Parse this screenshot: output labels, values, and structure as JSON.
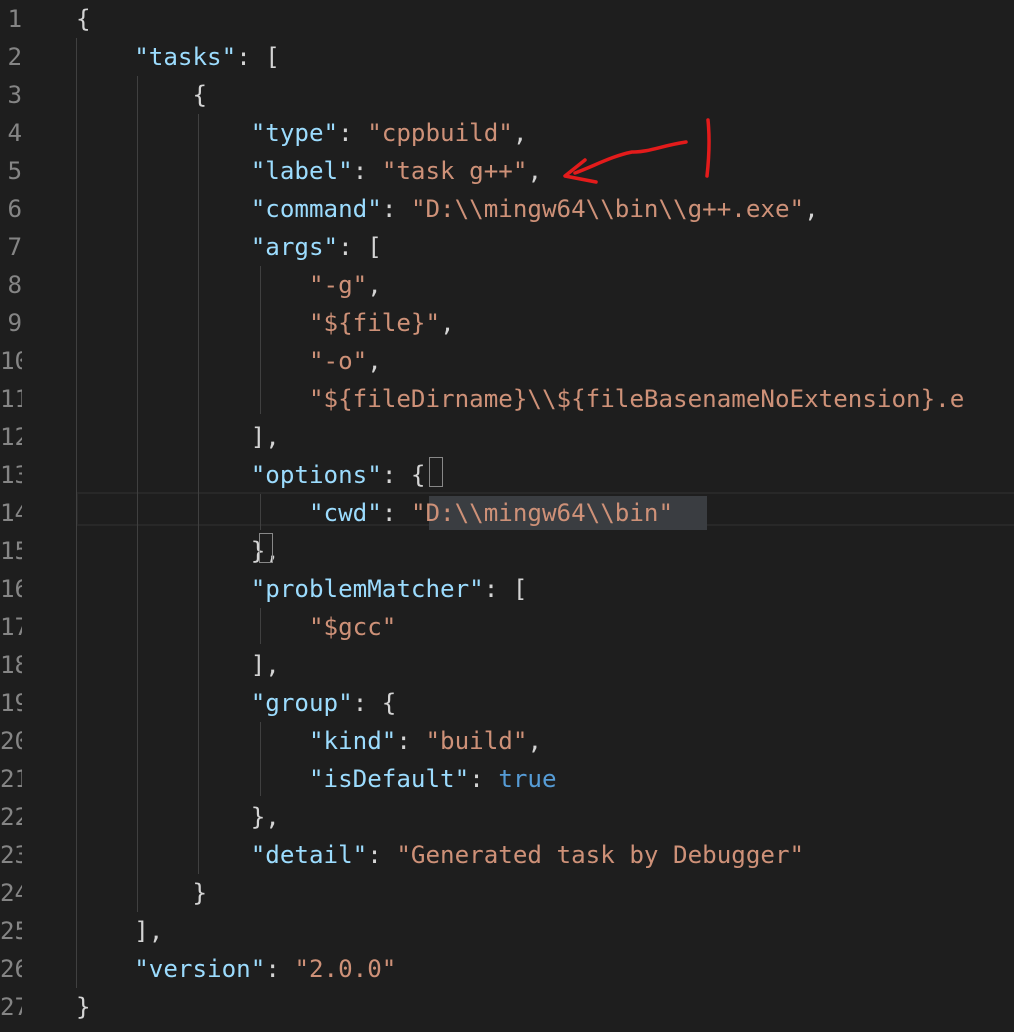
{
  "editor": {
    "language": "json",
    "lines": [
      {
        "number": "1",
        "tokens": [
          {
            "t": "p",
            "v": "{"
          }
        ]
      },
      {
        "number": "2",
        "tokens": [
          {
            "t": "p",
            "v": "    "
          },
          {
            "t": "k",
            "v": "\"tasks\""
          },
          {
            "t": "p",
            "v": ": ["
          }
        ]
      },
      {
        "number": "3",
        "tokens": [
          {
            "t": "p",
            "v": "        {"
          }
        ]
      },
      {
        "number": "4",
        "tokens": [
          {
            "t": "p",
            "v": "            "
          },
          {
            "t": "k",
            "v": "\"type\""
          },
          {
            "t": "p",
            "v": ": "
          },
          {
            "t": "s",
            "v": "\"cppbuild\""
          },
          {
            "t": "p",
            "v": ","
          }
        ]
      },
      {
        "number": "5",
        "tokens": [
          {
            "t": "p",
            "v": "            "
          },
          {
            "t": "k",
            "v": "\"label\""
          },
          {
            "t": "p",
            "v": ": "
          },
          {
            "t": "s",
            "v": "\"task g++\""
          },
          {
            "t": "p",
            "v": ","
          }
        ]
      },
      {
        "number": "6",
        "tokens": [
          {
            "t": "p",
            "v": "            "
          },
          {
            "t": "k",
            "v": "\"command\""
          },
          {
            "t": "p",
            "v": ": "
          },
          {
            "t": "s",
            "v": "\"D:\\\\mingw64\\\\bin\\\\g++.exe\""
          },
          {
            "t": "p",
            "v": ","
          }
        ]
      },
      {
        "number": "7",
        "tokens": [
          {
            "t": "p",
            "v": "            "
          },
          {
            "t": "k",
            "v": "\"args\""
          },
          {
            "t": "p",
            "v": ": ["
          }
        ]
      },
      {
        "number": "8",
        "tokens": [
          {
            "t": "p",
            "v": "                "
          },
          {
            "t": "s",
            "v": "\"-g\""
          },
          {
            "t": "p",
            "v": ","
          }
        ]
      },
      {
        "number": "9",
        "tokens": [
          {
            "t": "p",
            "v": "                "
          },
          {
            "t": "s",
            "v": "\"${file}\""
          },
          {
            "t": "p",
            "v": ","
          }
        ]
      },
      {
        "number": "10",
        "tokens": [
          {
            "t": "p",
            "v": "                "
          },
          {
            "t": "s",
            "v": "\"-o\""
          },
          {
            "t": "p",
            "v": ","
          }
        ]
      },
      {
        "number": "11",
        "tokens": [
          {
            "t": "p",
            "v": "                "
          },
          {
            "t": "s",
            "v": "\"${fileDirname}\\\\${fileBasenameNoExtension}.e"
          }
        ]
      },
      {
        "number": "12",
        "tokens": [
          {
            "t": "p",
            "v": "            ],"
          }
        ]
      },
      {
        "number": "13",
        "tokens": [
          {
            "t": "p",
            "v": "            "
          },
          {
            "t": "k",
            "v": "\"options\""
          },
          {
            "t": "p",
            "v": ": {"
          }
        ]
      },
      {
        "number": "14",
        "tokens": [
          {
            "t": "p",
            "v": "                "
          },
          {
            "t": "k",
            "v": "\"cwd\""
          },
          {
            "t": "p",
            "v": ": "
          },
          {
            "t": "s",
            "v": "\"D:\\\\mingw64\\\\bin\""
          }
        ]
      },
      {
        "number": "15",
        "tokens": [
          {
            "t": "p",
            "v": "            },"
          }
        ]
      },
      {
        "number": "16",
        "tokens": [
          {
            "t": "p",
            "v": "            "
          },
          {
            "t": "k",
            "v": "\"problemMatcher\""
          },
          {
            "t": "p",
            "v": ": ["
          }
        ]
      },
      {
        "number": "17",
        "tokens": [
          {
            "t": "p",
            "v": "                "
          },
          {
            "t": "s",
            "v": "\"$gcc\""
          }
        ]
      },
      {
        "number": "18",
        "tokens": [
          {
            "t": "p",
            "v": "            ],"
          }
        ]
      },
      {
        "number": "19",
        "tokens": [
          {
            "t": "p",
            "v": "            "
          },
          {
            "t": "k",
            "v": "\"group\""
          },
          {
            "t": "p",
            "v": ": {"
          }
        ]
      },
      {
        "number": "20",
        "tokens": [
          {
            "t": "p",
            "v": "                "
          },
          {
            "t": "k",
            "v": "\"kind\""
          },
          {
            "t": "p",
            "v": ": "
          },
          {
            "t": "s",
            "v": "\"build\""
          },
          {
            "t": "p",
            "v": ","
          }
        ]
      },
      {
        "number": "21",
        "tokens": [
          {
            "t": "p",
            "v": "                "
          },
          {
            "t": "k",
            "v": "\"isDefault\""
          },
          {
            "t": "p",
            "v": ": "
          },
          {
            "t": "b",
            "v": "true"
          }
        ]
      },
      {
        "number": "22",
        "tokens": [
          {
            "t": "p",
            "v": "            },"
          }
        ]
      },
      {
        "number": "23",
        "tokens": [
          {
            "t": "p",
            "v": "            "
          },
          {
            "t": "k",
            "v": "\"detail\""
          },
          {
            "t": "p",
            "v": ": "
          },
          {
            "t": "s",
            "v": "\"Generated task by Debugger\""
          }
        ]
      },
      {
        "number": "24",
        "tokens": [
          {
            "t": "p",
            "v": "        }"
          }
        ]
      },
      {
        "number": "25",
        "tokens": [
          {
            "t": "p",
            "v": "    ],"
          }
        ]
      },
      {
        "number": "26",
        "tokens": [
          {
            "t": "p",
            "v": "    "
          },
          {
            "t": "k",
            "v": "\"version\""
          },
          {
            "t": "p",
            "v": ": "
          },
          {
            "t": "s",
            "v": "\"2.0.0\""
          }
        ]
      },
      {
        "number": "27",
        "tokens": [
          {
            "t": "p",
            "v": "}"
          }
        ]
      }
    ],
    "current_line": "14",
    "selected_text": "\"D:\\\\mingw64\\\\bin\""
  },
  "annotation": {
    "color": "#e31b1b",
    "shape": "hand-drawn red arrow pointing at the comma after the label value"
  },
  "colors": {
    "background": "#1e1e1e",
    "key": "#9cdcfe",
    "string": "#ce9178",
    "keyword": "#569cd6",
    "punctuation": "#d4d4d4",
    "line_number": "#858585"
  }
}
